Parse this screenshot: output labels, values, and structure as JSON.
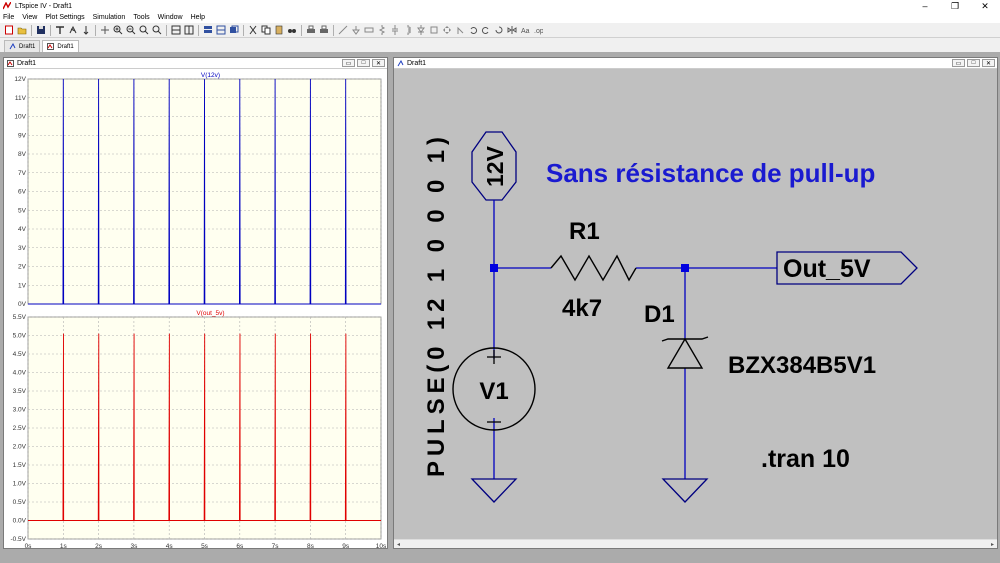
{
  "window": {
    "title": "LTspice IV - Draft1"
  },
  "menu": [
    "File",
    "View",
    "Plot Settings",
    "Simulation",
    "Tools",
    "Window",
    "Help"
  ],
  "tabs": [
    {
      "label": "Draft1",
      "kind": "schematic"
    },
    {
      "label": "Draft1",
      "kind": "waveform"
    }
  ],
  "waveform_window": {
    "title": "Draft1"
  },
  "schematic_window": {
    "title": "Draft1"
  },
  "schematic": {
    "title_text": "Sans résistance de pull-up",
    "source_label": "12V",
    "output_label": "Out_5V",
    "r1_name": "R1",
    "r1_value": "4k7",
    "d1_name": "D1",
    "d1_model": "BZX384B5V1",
    "v1_name": "V1",
    "v1_value": "PULSE(0 12 1 0 0 0 1)",
    "directive": ".tran 10",
    "colors": {
      "wire": "#0000c0",
      "title": "#1a1ad0",
      "background": "#c0c0c0"
    }
  },
  "chart_data": [
    {
      "type": "line",
      "title": "V(12v)",
      "x": [
        0,
        0.99,
        1.0,
        1.01,
        1.99,
        2.0,
        2.01,
        2.99,
        3.0,
        3.01,
        3.99,
        4.0,
        4.01,
        4.99,
        5.0,
        5.01,
        5.99,
        6.0,
        6.01,
        6.99,
        7.0,
        7.01,
        7.99,
        8.0,
        8.01,
        8.99,
        9.0,
        9.01,
        10
      ],
      "series": [
        {
          "name": "V(12v)",
          "color": "#0000c0",
          "values": [
            0,
            0,
            12,
            0,
            0,
            12,
            0,
            0,
            12,
            0,
            0,
            12,
            0,
            0,
            12,
            0,
            0,
            12,
            0,
            0,
            12,
            0,
            0,
            12,
            0,
            0,
            12,
            0,
            0
          ]
        }
      ],
      "xlim": [
        0,
        10
      ],
      "ylim": [
        0,
        12
      ],
      "yticks": [
        "0V",
        "1V",
        "2V",
        "3V",
        "4V",
        "5V",
        "6V",
        "7V",
        "8V",
        "9V",
        "10V",
        "11V",
        "12V"
      ],
      "grid": true
    },
    {
      "type": "line",
      "title": "V(out_5v)",
      "x": [
        0,
        0.99,
        1.005,
        1.01,
        1.99,
        2.005,
        2.01,
        2.99,
        3.005,
        3.01,
        3.99,
        4.005,
        4.01,
        4.99,
        5.005,
        5.01,
        5.99,
        6.005,
        6.01,
        6.99,
        7.005,
        7.01,
        7.99,
        8.005,
        8.01,
        8.99,
        9.005,
        9.01,
        10
      ],
      "series": [
        {
          "name": "V(out_5v)",
          "color": "#e00000",
          "values": [
            0,
            0,
            5.05,
            0,
            0,
            5.05,
            0,
            0,
            5.05,
            0,
            0,
            5.05,
            0,
            0,
            5.05,
            0,
            0,
            5.05,
            0,
            0,
            5.05,
            0,
            0,
            5.05,
            0,
            0,
            5.05,
            0,
            0
          ]
        }
      ],
      "xlim": [
        0,
        10
      ],
      "ylim": [
        -0.5,
        5.5
      ],
      "yticks": [
        "-0.5V",
        "0.0V",
        "0.5V",
        "1.0V",
        "1.5V",
        "2.0V",
        "2.5V",
        "3.0V",
        "3.5V",
        "4.0V",
        "4.5V",
        "5.0V",
        "5.5V"
      ],
      "xticks": [
        "0s",
        "1s",
        "2s",
        "3s",
        "4s",
        "5s",
        "6s",
        "7s",
        "8s",
        "9s",
        "10s"
      ],
      "grid": true
    }
  ]
}
